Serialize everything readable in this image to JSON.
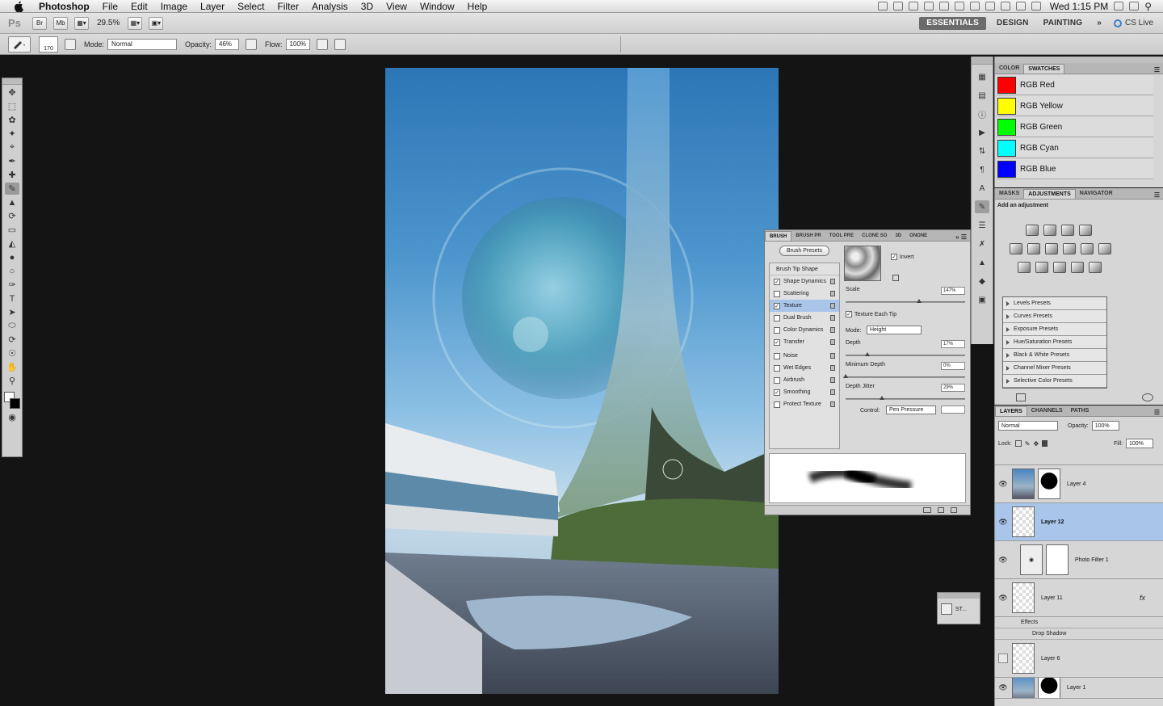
{
  "menubar": {
    "app_name": "Photoshop",
    "items": [
      "File",
      "Edit",
      "Image",
      "Layer",
      "Select",
      "Filter",
      "Analysis",
      "3D",
      "View",
      "Window",
      "Help"
    ],
    "clock": "Wed 1:15 PM"
  },
  "appbar": {
    "ps_logo": "Ps",
    "bridge_label": "Br",
    "minibridge_label": "Mb",
    "zoom": "29.5%",
    "workspaces": [
      "ESSENTIALS",
      "DESIGN",
      "PAINTING"
    ],
    "more": "»",
    "cs_live": "CS Live"
  },
  "options": {
    "brush_size": "170",
    "mode_label": "Mode:",
    "mode_value": "Normal",
    "opacity_label": "Opacity:",
    "opacity_value": "46%",
    "flow_label": "Flow:",
    "flow_value": "100%"
  },
  "swatches_panel": {
    "tabs": [
      "COLOR",
      "SWATCHES"
    ],
    "swatches": [
      {
        "name": "RGB Red",
        "color": "#ff0000"
      },
      {
        "name": "RGB Yellow",
        "color": "#ffff00"
      },
      {
        "name": "RGB Green",
        "color": "#00ff00"
      },
      {
        "name": "RGB Cyan",
        "color": "#00ffff"
      },
      {
        "name": "RGB Blue",
        "color": "#0000ff"
      }
    ]
  },
  "adjustments_panel": {
    "tabs": [
      "MASKS",
      "ADJUSTMENTS",
      "NAVIGATOR"
    ],
    "subtitle": "Add an adjustment",
    "presets": [
      "Levels Presets",
      "Curves Presets",
      "Exposure Presets",
      "Hue/Saturation Presets",
      "Black & White Presets",
      "Channel Mixer Presets",
      "Selective Color Presets"
    ]
  },
  "layers_panel": {
    "tabs": [
      "LAYERS",
      "CHANNELS",
      "PATHS"
    ],
    "blend_mode": "Normal",
    "opacity_label": "Opacity:",
    "opacity_value": "100%",
    "lock_label": "Lock:",
    "fill_label": "Fill:",
    "fill_value": "100%",
    "layers": [
      "Layer 4",
      "Layer 12",
      "Photo Filter 1",
      "Layer 11",
      "Layer 6",
      "Layer 1"
    ],
    "effects_label": "Effects",
    "drop_shadow_label": "Drop Shadow",
    "fx_label": "fx"
  },
  "brush_panel": {
    "tabs": [
      "BRUSH",
      "BRUSH PR",
      "TOOL PRE",
      "CLONE SO",
      "3D",
      "ONONE"
    ],
    "presets_button": "Brush Presets",
    "tip_shape": "Brush Tip Shape",
    "options": [
      {
        "label": "Shape Dynamics",
        "checked": true
      },
      {
        "label": "Scattering",
        "checked": false
      },
      {
        "label": "Texture",
        "checked": true
      },
      {
        "label": "Dual Brush",
        "checked": false
      },
      {
        "label": "Color Dynamics",
        "checked": false
      },
      {
        "label": "Transfer",
        "checked": true
      },
      {
        "label": "Noise",
        "checked": false
      },
      {
        "label": "Wet Edges",
        "checked": false
      },
      {
        "label": "Airbrush",
        "checked": false
      },
      {
        "label": "Smoothing",
        "checked": true
      },
      {
        "label": "Protect Texture",
        "checked": false
      }
    ],
    "invert_label": "Invert",
    "scale_label": "Scale",
    "scale_value": "147%",
    "texture_each_tip": "Texture Each Tip",
    "mode_label": "Mode:",
    "mode_value": "Height",
    "depth_label": "Depth",
    "depth_value": "17%",
    "min_depth_label": "Minimum Depth",
    "min_depth_value": "0%",
    "depth_jitter_label": "Depth Jitter",
    "depth_jitter_value": "29%",
    "control_label": "Control:",
    "control_value": "Pen Pressure"
  },
  "styles_mini": {
    "label": "ST..."
  }
}
